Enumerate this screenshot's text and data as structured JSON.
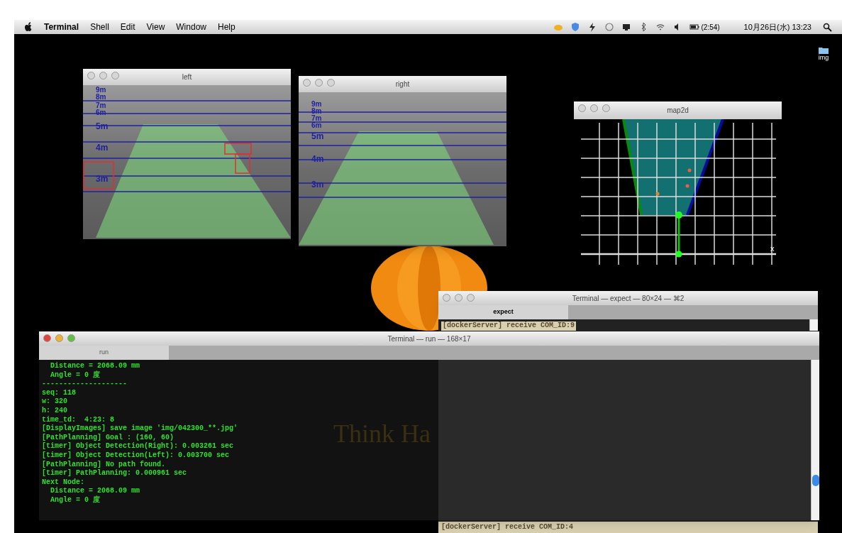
{
  "menubar": {
    "app_name": "Terminal",
    "menus": [
      "Shell",
      "Edit",
      "View",
      "Window",
      "Help"
    ],
    "battery_time": "(2:54)",
    "clock": "10月26日(水) 13:23"
  },
  "desktop_icons": [
    {
      "label": "img"
    }
  ],
  "wallpaper_text": "Think Ha",
  "windows": [
    {
      "kind": "camera",
      "title": "left",
      "active": false,
      "distance_labels": [
        "9m",
        "8m",
        "7m",
        "6m",
        "5m",
        "4m",
        "3m"
      ]
    },
    {
      "kind": "camera",
      "title": "right",
      "active": false,
      "distance_labels": [
        "9m",
        "8m",
        "7m",
        "6m",
        "5m",
        "4m",
        "3m"
      ]
    },
    {
      "kind": "map",
      "title": "map2d",
      "active": false,
      "axis_label": "x"
    },
    {
      "kind": "terminal",
      "title": "Terminal — expect — 80×24 — ⌘2",
      "active": false,
      "tab": "expect",
      "lines": [
        "[dockerServer] receive COM_ID:9"
      ],
      "footer": "[dockerServer] receive COM_ID:4"
    },
    {
      "kind": "terminal",
      "title": "Terminal — run — 168×17",
      "active": true,
      "tab": "run",
      "lines": [
        "  Distance = 2068.09 mm",
        "  Angle = 0 度",
        "--------------------",
        "seq: 118",
        "w: 320",
        "h: 240",
        "time_td:  4:23: 8",
        "[DisplayImages] save image 'img/042300_**.jpg'",
        "[PathPlanning] Goal : (160, 60)",
        "[timer] Object Detection(Right): 0.003261 sec",
        "[timer] Object Detection(Left): 0.003700 sec",
        "[PathPlanning] No path found.",
        "[timer] PathPlanning: 0.000961 sec",
        "Next Node:",
        "  Distance = 2068.09 mm",
        "  Angle = 0 度"
      ]
    }
  ]
}
